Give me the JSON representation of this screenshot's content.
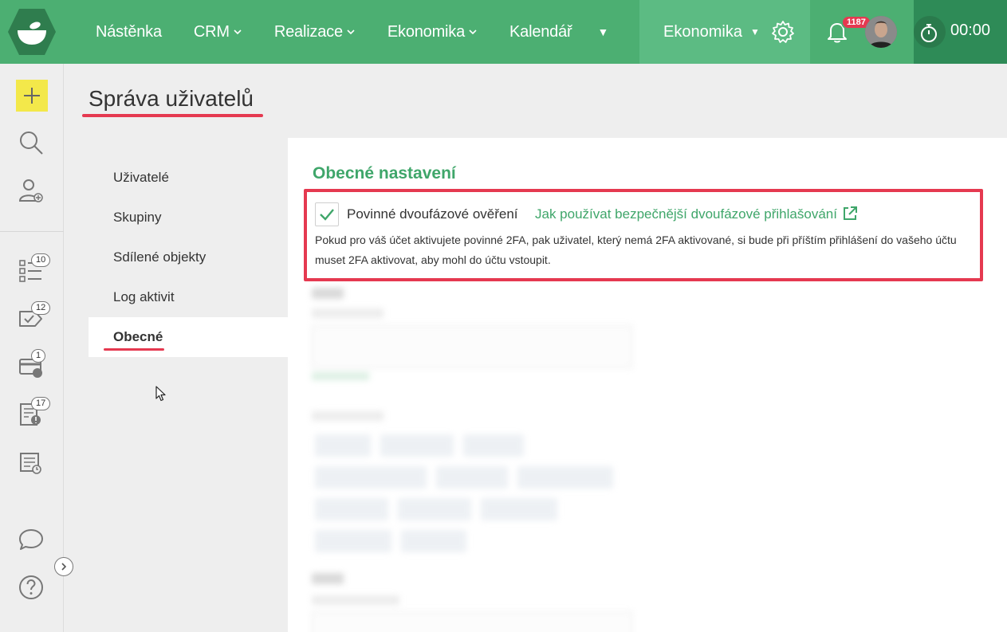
{
  "topbar": {
    "nav": [
      {
        "label": "Nástěnka",
        "has_dropdown": false
      },
      {
        "label": "CRM",
        "has_dropdown": true
      },
      {
        "label": "Realizace",
        "has_dropdown": true
      },
      {
        "label": "Ekonomika",
        "has_dropdown": true
      },
      {
        "label": "Kalendář",
        "has_dropdown": false
      }
    ],
    "module_switch": "Ekonomika",
    "notification_count": "1187",
    "timer": "00:00",
    "colors": {
      "bar": "#4caf72",
      "switch": "#5cbb83",
      "timer": "#2e8b57",
      "badge": "#e53950"
    }
  },
  "rail": {
    "badges": {
      "tasks": "10",
      "approvals": "12",
      "payments": "1",
      "issues": "17"
    }
  },
  "page": {
    "title": "Správa uživatelů"
  },
  "submenu": {
    "items": [
      "Uživatelé",
      "Skupiny",
      "Sdílené objekty",
      "Log aktivit",
      "Obecné"
    ],
    "active": "Obecné"
  },
  "settings": {
    "section_title": "Obecné nastavení",
    "twofa_checked": true,
    "twofa_label": "Povinné dvoufázové ověření",
    "twofa_help_link": "Jak používat bezpečnější dvoufázové přihlašování",
    "twofa_description": "Pokud pro váš účet aktivujete povinné 2FA, pak uživatel, který nemá 2FA aktivované, si bude při příštím přihlášení do vašeho účtu muset 2FA aktivovat, aby mohl do účtu vstoupit."
  },
  "colors": {
    "accent": "#3fa66a",
    "highlight": "#e53950",
    "add_button": "#f3e84a"
  }
}
